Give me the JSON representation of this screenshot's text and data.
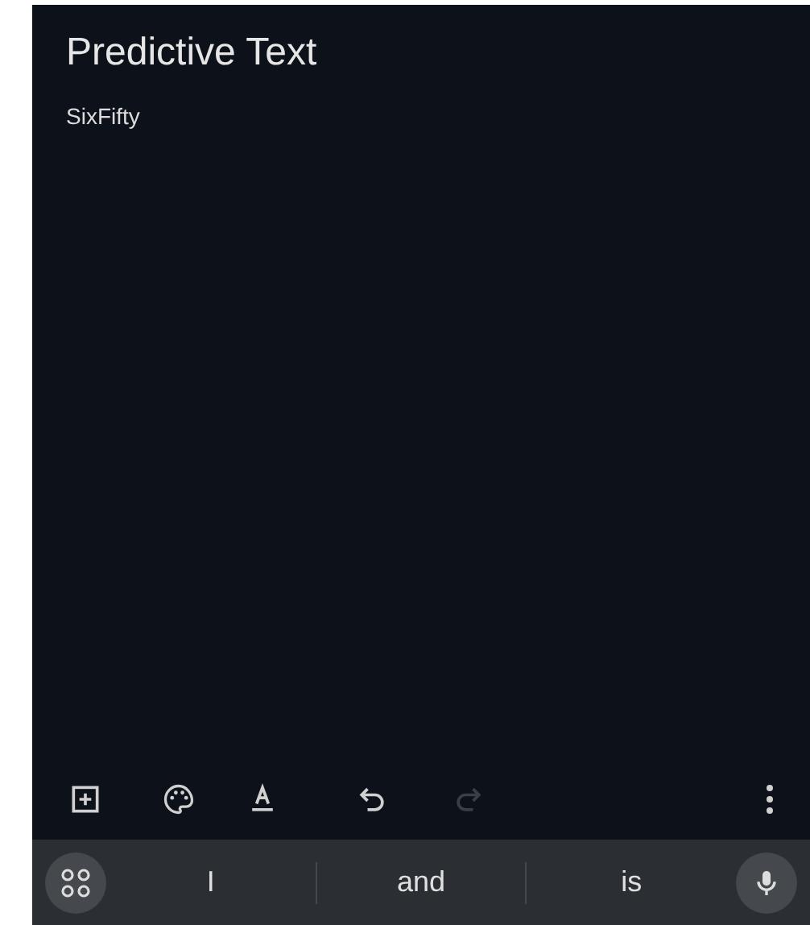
{
  "note": {
    "title": "Predictive Text",
    "body": "SixFifty"
  },
  "toolbar": [
    {
      "kind": "add",
      "disabled": false
    },
    {
      "kind": "palette",
      "disabled": false
    },
    {
      "kind": "format",
      "disabled": false
    },
    {
      "kind": "undo",
      "disabled": false
    },
    {
      "kind": "redo",
      "disabled": true
    },
    {
      "kind": "more",
      "disabled": false
    }
  ],
  "suggestions": [
    "I",
    "and",
    "is"
  ]
}
